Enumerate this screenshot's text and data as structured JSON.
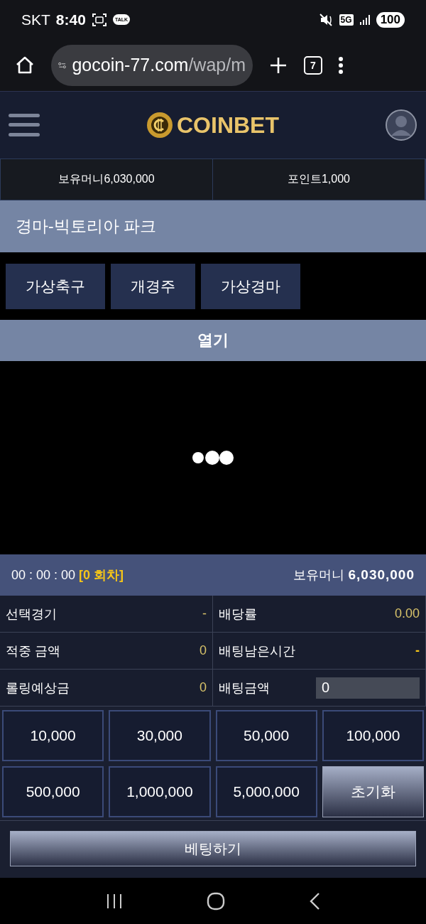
{
  "status_bar": {
    "carrier": "SKT",
    "time": "8:40",
    "talk_badge": "TALK",
    "network": "5G",
    "battery": "100"
  },
  "browser": {
    "url_host": "gocoin-77.com",
    "url_path": "/wap/m",
    "tab_count": "7"
  },
  "header": {
    "logo_text": "COINBET"
  },
  "balance_bar": [
    "보유머니6,030,000",
    "포인트1,000"
  ],
  "page_title": "경마-빅토리아 파크",
  "game_tabs": [
    "가상축구",
    "개경주",
    "가상경마"
  ],
  "open_button": "열기",
  "info_bar": {
    "timer": "00 : 00 : 00",
    "round": "[0 회차]",
    "balance_label": "보유머니",
    "balance_value": "6,030,000"
  },
  "bet_table": [
    {
      "label": "선택경기",
      "value": "-",
      "kind": "text"
    },
    {
      "label": "배당률",
      "value": "0.00",
      "kind": "text"
    },
    {
      "label": "적중 금액",
      "value": "0",
      "kind": "text"
    },
    {
      "label": "배팅남은시간",
      "value": "-",
      "kind": "strong"
    },
    {
      "label": "롤링예상금",
      "value": "0",
      "kind": "text"
    },
    {
      "label": "배팅금액",
      "value": "0",
      "kind": "input"
    }
  ],
  "amount_buttons": [
    {
      "label": "10,000",
      "kind": "amount"
    },
    {
      "label": "30,000",
      "kind": "amount"
    },
    {
      "label": "50,000",
      "kind": "amount"
    },
    {
      "label": "100,000",
      "kind": "amount"
    },
    {
      "label": "500,000",
      "kind": "amount"
    },
    {
      "label": "1,000,000",
      "kind": "amount"
    },
    {
      "label": "5,000,000",
      "kind": "amount"
    },
    {
      "label": "초기화",
      "kind": "reset"
    }
  ],
  "bet_button": "베팅하기"
}
